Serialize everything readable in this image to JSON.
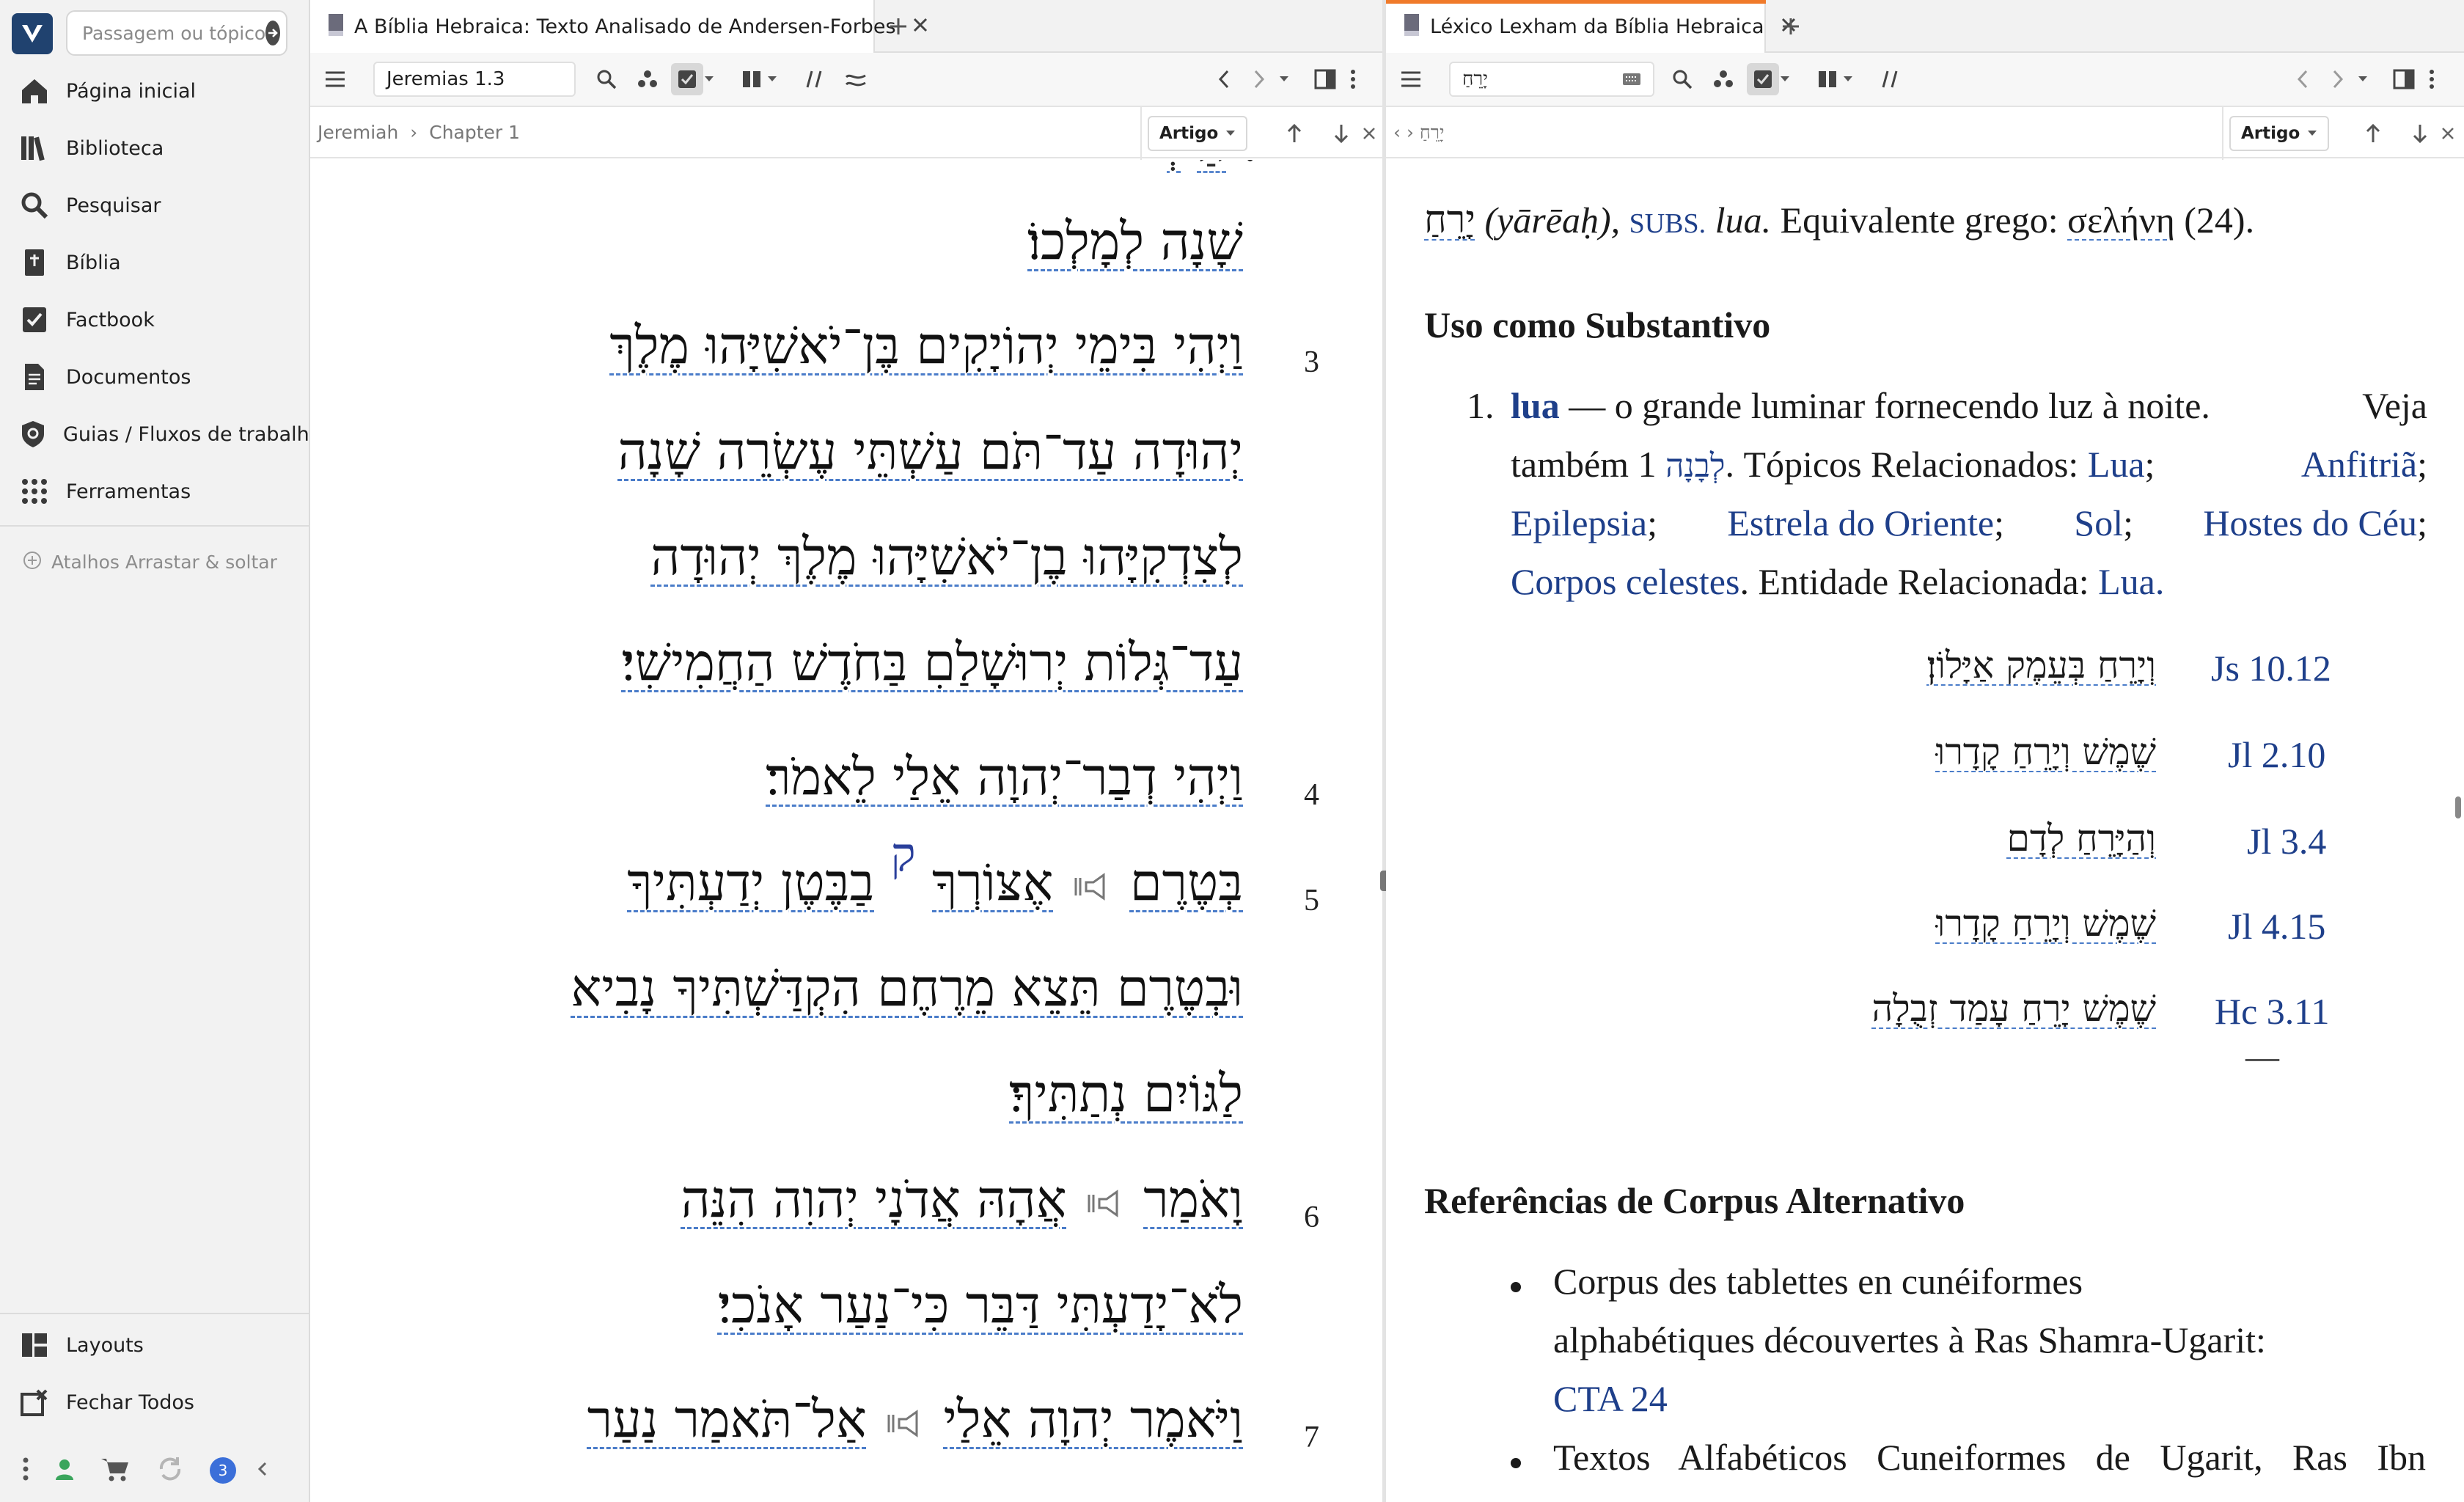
{
  "sidebar": {
    "search_placeholder": "Passagem ou tópico",
    "items": [
      {
        "label": "Página inicial",
        "icon": "home-icon"
      },
      {
        "label": "Biblioteca",
        "icon": "library-icon"
      },
      {
        "label": "Pesquisar",
        "icon": "search-icon"
      },
      {
        "label": "Bíblia",
        "icon": "bible-icon"
      },
      {
        "label": "Factbook",
        "icon": "factbook-icon"
      },
      {
        "label": "Documentos",
        "icon": "document-icon"
      },
      {
        "label": "Guias / Fluxos de trabalho",
        "icon": "guides-icon"
      },
      {
        "label": "Ferramentas",
        "icon": "tools-icon"
      }
    ],
    "shortcuts_label": "Atalhos Arrastar & soltar",
    "bottom_items": [
      {
        "label": "Layouts",
        "icon": "layouts-icon"
      },
      {
        "label": "Fechar Todos",
        "icon": "close-all-icon"
      }
    ],
    "notification_count": "3"
  },
  "panel_left": {
    "tab_title": "A Bíblia Hebraica: Texto Analisado de Andersen-Forbes",
    "reference": "Jeremias 1.3",
    "breadcrumb": [
      "Jeremiah",
      "Chapter 1"
    ],
    "mode": "Artigo",
    "lines": [
      {
        "verse": "",
        "text": "שָׁנָה לְמָלְכוֹ׃"
      },
      {
        "verse": "3",
        "text": "וַיְהִי בִּימֵי יְהוֹיָקִים בֶּן־יֹאשִׁיָּהוּ מֶלֶךְ"
      },
      {
        "verse": "",
        "text": "יְהוּדָה עַד־תֹּם עַשְׁתֵּי עֶשְׂרֵה שָׁנָה"
      },
      {
        "verse": "",
        "text": "לְצִדְקִיָּהוּ בֶן־יֹאשִׁיָּהוּ מֶלֶךְ יְהוּדָה"
      },
      {
        "verse": "",
        "text": "עַד־גְּלוֹת יְרוּשָׁלַםִ בַּחֹדֶשׁ הַחֲמִישִׁי׃"
      },
      {
        "verse": "4",
        "text": "וַיְהִי דְבַר־יְהוָה אֵלַי לֵאמֹר׃"
      },
      {
        "verse": "5",
        "text_a": "בְּטֶרֶם",
        "text_b": "אֶצּוֹרְךָ",
        "qere": "ק",
        "text_c": "בַבֶּטֶן יְדַעְתִּיךָ"
      },
      {
        "verse": "",
        "text": "וּבְטֶרֶם תֵּצֵא מֵרֶחֶם הִקְדַּשְׁתִּיךָ נָבִיא"
      },
      {
        "verse": "",
        "text": "לַגּוֹיִם נְתַתִּיךָ׃"
      },
      {
        "verse": "6",
        "text_a": "וָאֹמַר",
        "text_b": "אֲהָהּ אֲדֹנָי יְהוִה הִנֵּה"
      },
      {
        "verse": "",
        "text": "לֹא־יָדַעְתִּי דַּבֵּר כִּי־נַעַר אָנֹכִי׃"
      },
      {
        "verse": "7",
        "text_a": "וַיֹּאמֶר יְהוָה אֵלַי",
        "text_b": "אַל־תֹּאמַר נַעַר"
      }
    ]
  },
  "panel_right": {
    "tab_title": "Léxico Lexham da Bíblia Hebraica",
    "search_value": "יָרֵחַ",
    "breadcrumb": "יָרֵחַ",
    "mode": "Artigo",
    "entry": {
      "lemma": "יָרֵחַ",
      "translit": "(yārēaḥ),",
      "pos": "SUBS.",
      "gloss": "lua.",
      "greek_label": "Equivalente grego:",
      "greek_word": "σελήνη",
      "greek_count": "(24)."
    },
    "section1_title": "Uso como Substantivo",
    "sense": {
      "number": "1.",
      "term": "lua",
      "definition": "— o grande luminar fornecendo luz à noite.",
      "see_also_label": "Veja",
      "see_also_label2": "também",
      "see_also_word": "לְבָנָה",
      "see_also_num": "1.",
      "topics_label": "Tópicos Relacionados:",
      "topics": [
        "Lua",
        "Anfitriã",
        "Epilepsia",
        "Estrela do Oriente",
        "Sol",
        "Hostes do Céu",
        "Corpos celestes"
      ],
      "entity_label": "Entidade Relacionada:",
      "entity": "Lua."
    },
    "examples": [
      {
        "hebrew": "וְיָרֵחַ בְּעֵמֶק אַיָּלוֹן׃",
        "ref": "Js 10.12"
      },
      {
        "hebrew": "שֶׁמֶשׁ וְיָרֵחַ קָדָרוּ",
        "ref": "Jl 2.10"
      },
      {
        "hebrew": "וְהַיָּרֵחַ לְדָם",
        "ref": "Jl 3.4"
      },
      {
        "hebrew": "שֶׁמֶשׁ וְיָרֵחַ קָדָרוּ",
        "ref": "Jl 4.15"
      },
      {
        "hebrew": "שֶׁמֶשׁ יָרֵחַ עָמַד זְבֻלָה",
        "ref": "Hc 3.11"
      }
    ],
    "examples_end": "—",
    "section2_title": "Referências de Corpus Alternativo",
    "corpus": [
      {
        "line1": "Corpus des tablettes en cunéiformes",
        "line2": "alphabétiques découvertes à Ras Shamra-Ugarit:",
        "link": "CTA 24"
      },
      {
        "line1": "Textos Alfabéticos Cuneiformes de Ugarit, Ras Ibn"
      }
    ]
  },
  "colors": {
    "accent_tab": "#f07a2a",
    "link": "#1e3f8a",
    "logo_bg": "#20426f",
    "badge": "#3b6fd9"
  }
}
